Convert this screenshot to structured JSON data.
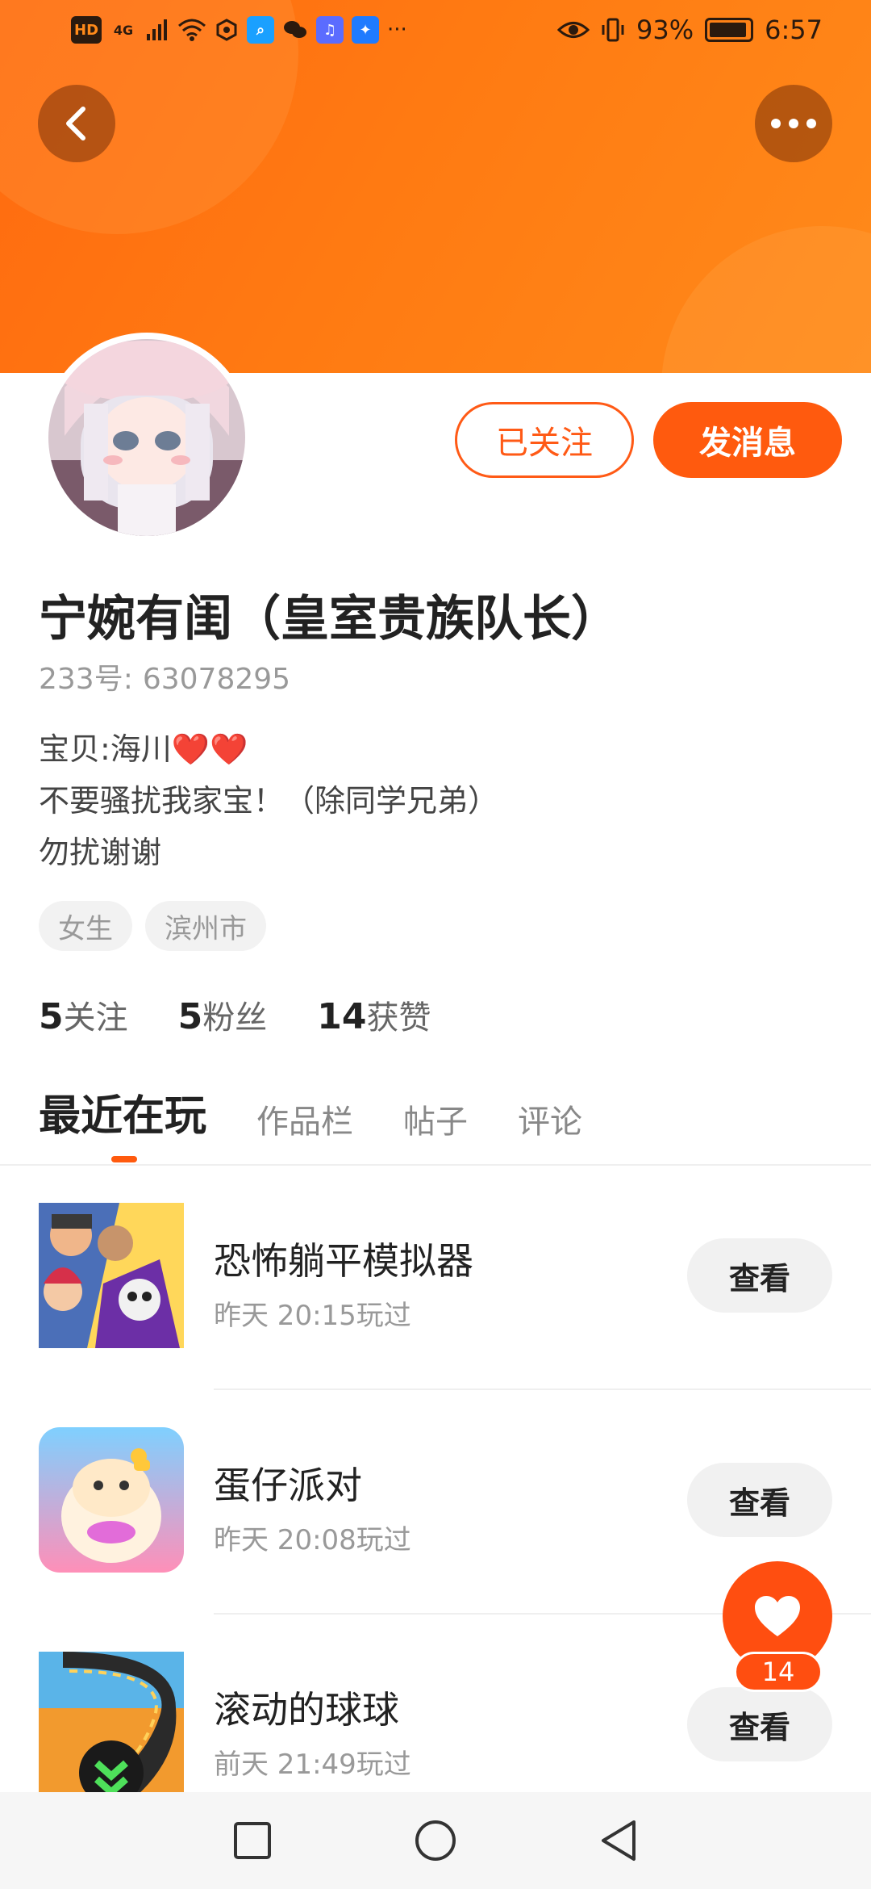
{
  "status_bar": {
    "left_labels": [
      "HD",
      "4G"
    ],
    "battery_percent": "93%",
    "battery_level": 0.93,
    "time": "6:57"
  },
  "header": {
    "back_icon": "chevron-left-icon",
    "more_icon": "more-dots-icon",
    "colors": {
      "accent": "#ff5a0e",
      "banner": "#ff7a12"
    }
  },
  "profile": {
    "follow_label": "已关注",
    "message_label": "发消息",
    "name": "宁婉有闺（皇室贵族队长）",
    "uid_label": "233号:",
    "uid": "63078295",
    "bio": {
      "line1": "宝贝:海川",
      "line1_hearts": "❤️❤️",
      "line2": "不要骚扰我家宝！（除同学兄弟）",
      "line3": "勿扰谢谢"
    },
    "tags": [
      "女生",
      "滨州市"
    ]
  },
  "stats": [
    {
      "value": "5",
      "label": "关注"
    },
    {
      "value": "5",
      "label": "粉丝"
    },
    {
      "value": "14",
      "label": "获赞"
    }
  ],
  "tabs": [
    {
      "label": "最近在玩"
    },
    {
      "label": "作品栏"
    },
    {
      "label": "帖子"
    },
    {
      "label": "评论"
    }
  ],
  "games": [
    {
      "title": "恐怖躺平模拟器",
      "time": "昨天 20:15玩过",
      "view_label": "查看"
    },
    {
      "title": "蛋仔派对",
      "time": "昨天 20:08玩过",
      "view_label": "查看"
    },
    {
      "title": "滚动的球球",
      "time": "前天 21:49玩过",
      "view_label": "查看"
    }
  ],
  "like_fab": {
    "icon": "heart-icon",
    "count": "14"
  },
  "nav_bar": {
    "icons": [
      "square-icon",
      "circle-home-icon",
      "triangle-back-icon"
    ]
  }
}
